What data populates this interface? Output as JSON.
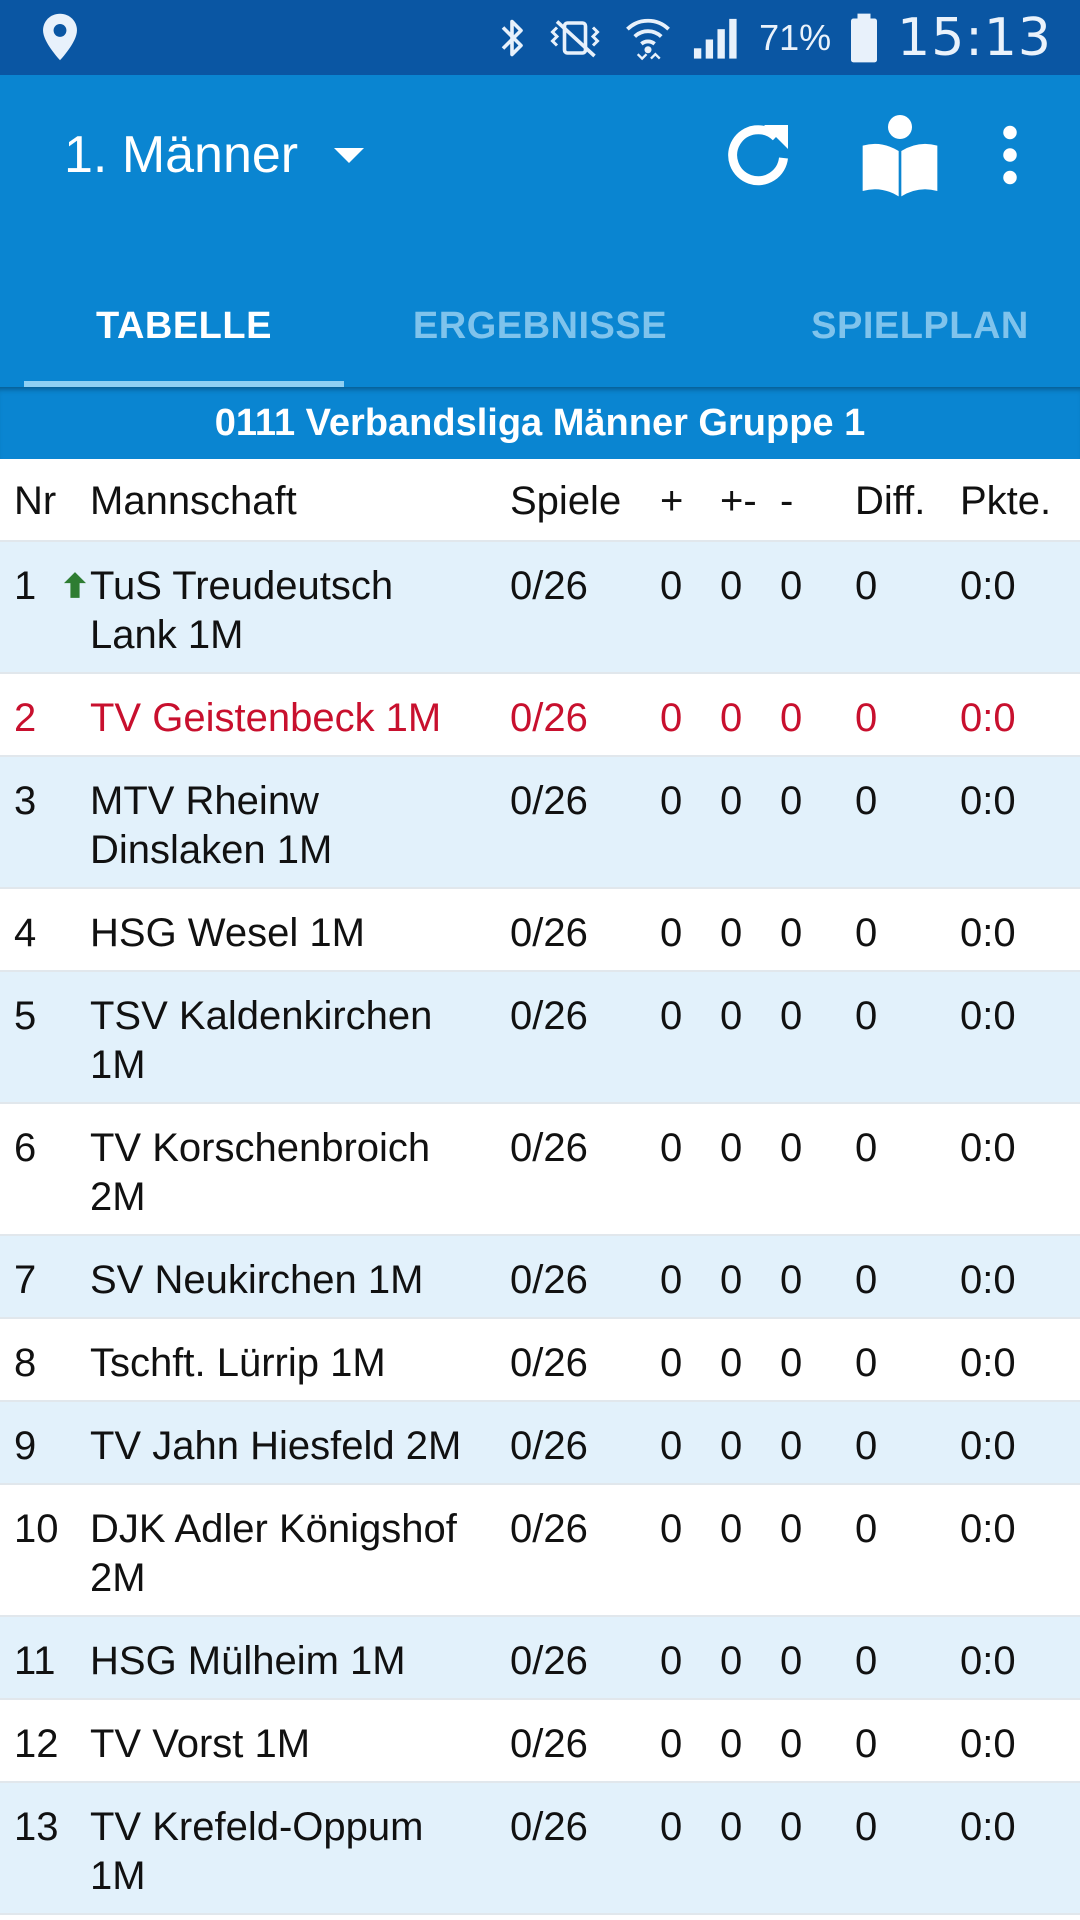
{
  "statusbar": {
    "battery_percent": "71%",
    "time": "15:13"
  },
  "appbar": {
    "title": "1. Männer"
  },
  "tabs": [
    {
      "label": "TABELLE",
      "active": true
    },
    {
      "label": "ERGEBNISSE",
      "active": false
    },
    {
      "label": "SPIELPLAN",
      "active": false
    }
  ],
  "league": {
    "title": "0111 Verbandsliga Männer Gruppe 1"
  },
  "table": {
    "columns": [
      "Nr",
      "Mannschaft",
      "Spiele",
      "+",
      "+-",
      "-",
      "Diff.",
      "Pkte."
    ],
    "rows": [
      {
        "nr": "1",
        "team": "TuS Treudeutsch Lank 1M",
        "spiele": "0/26",
        "plus": "0",
        "pm": "0",
        "minus": "0",
        "diff": "0",
        "pkte": "0:0",
        "promoted": true
      },
      {
        "nr": "2",
        "team": "TV Geistenbeck 1M",
        "spiele": "0/26",
        "plus": "0",
        "pm": "0",
        "minus": "0",
        "diff": "0",
        "pkte": "0:0",
        "highlight": true
      },
      {
        "nr": "3",
        "team": "MTV Rheinw Dinslaken 1M",
        "spiele": "0/26",
        "plus": "0",
        "pm": "0",
        "minus": "0",
        "diff": "0",
        "pkte": "0:0"
      },
      {
        "nr": "4",
        "team": "HSG Wesel 1M",
        "spiele": "0/26",
        "plus": "0",
        "pm": "0",
        "minus": "0",
        "diff": "0",
        "pkte": "0:0"
      },
      {
        "nr": "5",
        "team": "TSV Kaldenkirchen 1M",
        "spiele": "0/26",
        "plus": "0",
        "pm": "0",
        "minus": "0",
        "diff": "0",
        "pkte": "0:0"
      },
      {
        "nr": "6",
        "team": "TV Korschenbroich 2M",
        "spiele": "0/26",
        "plus": "0",
        "pm": "0",
        "minus": "0",
        "diff": "0",
        "pkte": "0:0"
      },
      {
        "nr": "7",
        "team": "SV Neukirchen 1M",
        "spiele": "0/26",
        "plus": "0",
        "pm": "0",
        "minus": "0",
        "diff": "0",
        "pkte": "0:0"
      },
      {
        "nr": "8",
        "team": "Tschft. Lürrip 1M",
        "spiele": "0/26",
        "plus": "0",
        "pm": "0",
        "minus": "0",
        "diff": "0",
        "pkte": "0:0"
      },
      {
        "nr": "9",
        "team": "TV Jahn Hiesfeld 2M",
        "spiele": "0/26",
        "plus": "0",
        "pm": "0",
        "minus": "0",
        "diff": "0",
        "pkte": "0:0"
      },
      {
        "nr": "10",
        "team": "DJK Adler Königshof 2M",
        "spiele": "0/26",
        "plus": "0",
        "pm": "0",
        "minus": "0",
        "diff": "0",
        "pkte": "0:0"
      },
      {
        "nr": "11",
        "team": "HSG Mülheim 1M",
        "spiele": "0/26",
        "plus": "0",
        "pm": "0",
        "minus": "0",
        "diff": "0",
        "pkte": "0:0"
      },
      {
        "nr": "12",
        "team": "TV Vorst 1M",
        "spiele": "0/26",
        "plus": "0",
        "pm": "0",
        "minus": "0",
        "diff": "0",
        "pkte": "0:0"
      },
      {
        "nr": "13",
        "team": "TV Krefeld-Oppum 1M",
        "spiele": "0/26",
        "plus": "0",
        "pm": "0",
        "minus": "0",
        "diff": "0",
        "pkte": "0:0"
      }
    ]
  },
  "colors": {
    "statusbar": "#0a56a3",
    "appbar": "#0a85d1",
    "row_alt": "#e2f1fb",
    "highlight_text": "#c8102e",
    "promoted_icon": "#2e7d32"
  }
}
